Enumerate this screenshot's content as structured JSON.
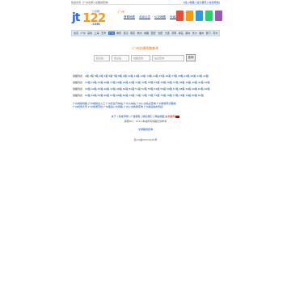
{
  "topbar": {
    "left": "欢迎访问（广州交通公交路线查询）",
    "right": "[加入收藏]  [设为首页]  [在线导航]"
  },
  "logo": {
    "mark": "jt",
    "digits": "122",
    "site": "公交网",
    "tld": ".com"
  },
  "city": "广州",
  "top_nav": [
    {
      "label": "首都地铁"
    },
    {
      "label": "北京公交"
    },
    {
      "label": "公交地图"
    },
    {
      "label": "长途客车"
    }
  ],
  "promo_colors": [
    "#e74c3c",
    "#f39c12",
    "#3498db",
    "#2ecc71",
    "#9b59b6"
  ],
  "city_nav": [
    {
      "label": "北京"
    },
    {
      "label": "广州"
    },
    {
      "label": "深圳"
    },
    {
      "label": "上海"
    },
    {
      "label": "天津"
    },
    {
      "label": "广州",
      "active": true
    },
    {
      "label": "重庆"
    },
    {
      "label": "武汉"
    },
    {
      "label": "南京"
    },
    {
      "label": "杭州"
    },
    {
      "label": "成都"
    },
    {
      "label": "西安"
    },
    {
      "label": "沈阳"
    },
    {
      "label": "大连"
    },
    {
      "label": "济南"
    },
    {
      "label": "青岛"
    },
    {
      "label": "郑州"
    },
    {
      "label": "长沙"
    },
    {
      "label": "福州"
    },
    {
      "label": "厦门"
    },
    {
      "label": "苏州"
    },
    {
      "label": "宁波"
    },
    {
      "label": "无锡"
    },
    {
      "label": "合肥"
    },
    {
      "label": "南昌"
    },
    {
      "label": "昆明"
    },
    {
      "label": "南宁"
    },
    {
      "label": "太原"
    },
    {
      "label": "更多"
    }
  ],
  "search": {
    "title": "广州交通线路查询",
    "from_placeholder": "起点站",
    "to_placeholder": "终点站",
    "line_placeholder": "线路查询",
    "station_placeholder": "站点查询",
    "button": "查询"
  },
  "line_rows": [
    {
      "label": "线路列表",
      "text": "1路 2路 3路 4路 5路 6路 7路 8路 9路 10路 11路 12路 13路 14路 15路 16路 17路 18路 19路 20路 21路 22路"
    },
    {
      "label": "线路列表",
      "text": "23路 24路 25路 26路 27路 28路 29路 30路 31路 32路 33路 34路 35路 36路 37路 38路 39路 40路 41路 42路"
    },
    {
      "label": "线路列表",
      "text": "43路 44路 45路 46路 47路 48路 49路 50路 51路 52路 53路 54路 55路 56路 57路 58路 59路 60路 61路 62路"
    },
    {
      "label": "线路列表",
      "text": "63路 64路 65路 66路 67路 68路 69路 70路 71路 72路 73路 74路 75路 76路 77路 78路 79路 80路 81路"
    }
  ],
  "related": [
    "广州地铁线路  广州地铁出入口  广州长途汽车站  广州火车站  广州公交站点查询  广州旅游景点路线",
    "广州机场大巴  广州旅游专线  广州夜班公交线路  广州公交换乘查询  广州客运站时刻表"
  ],
  "footer": {
    "line1": "关于  |  免责声明  |  广告服务  |  联系我们  |  网站地图",
    "hot": "站长推荐",
    "line2": "客服QQ：1234  本站所有线路仅供参考",
    "line3": "交通路线查询",
    "line4": "京ICP备05072035号"
  }
}
